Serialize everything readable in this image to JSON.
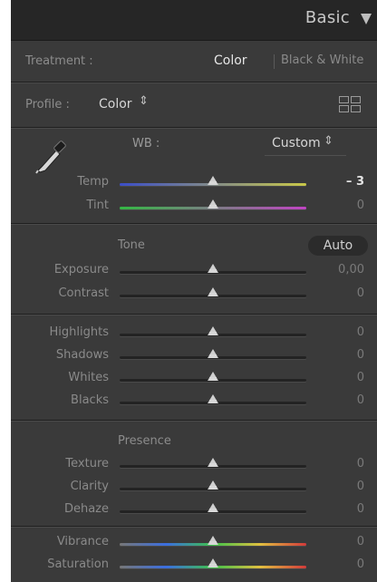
{
  "header": {
    "title": "Basic"
  },
  "treatment": {
    "label": "Treatment :",
    "color": "Color",
    "bw": "Black & White"
  },
  "profile": {
    "label": "Profile :",
    "value": "Color",
    "stepper": "⇕"
  },
  "wb": {
    "label": "WB :",
    "value": "Custom",
    "stepper": "⇕"
  },
  "temp": {
    "label": "Temp",
    "value": "– 3",
    "position": 0.5
  },
  "tint": {
    "label": "Tint",
    "value": "0",
    "position": 0.5
  },
  "tone": {
    "title": "Tone",
    "auto_label": "Auto"
  },
  "exposure": {
    "label": "Exposure",
    "value": "0,00",
    "position": 0.5
  },
  "contrast": {
    "label": "Contrast",
    "value": "0",
    "position": 0.5
  },
  "highlights": {
    "label": "Highlights",
    "value": "0",
    "position": 0.5
  },
  "shadows": {
    "label": "Shadows",
    "value": "0",
    "position": 0.5
  },
  "whites": {
    "label": "Whites",
    "value": "0",
    "position": 0.5
  },
  "blacks": {
    "label": "Blacks",
    "value": "0",
    "position": 0.5
  },
  "presence": {
    "title": "Presence"
  },
  "texture": {
    "label": "Texture",
    "value": "0",
    "position": 0.5
  },
  "clarity": {
    "label": "Clarity",
    "value": "0",
    "position": 0.5
  },
  "dehaze": {
    "label": "Dehaze",
    "value": "0",
    "position": 0.5
  },
  "vibrance": {
    "label": "Vibrance",
    "value": "0",
    "position": 0.5
  },
  "saturation": {
    "label": "Saturation",
    "value": "0",
    "position": 0.5
  },
  "colors": {
    "temp_gradient": [
      "#3b4ec8",
      "#c9c848"
    ],
    "tint_gradient": [
      "#34b844",
      "#c144c4"
    ],
    "vib_gradient": [
      "#777777",
      "#3b6ee0",
      "#3ec24a",
      "#e0c040",
      "#d23a3a"
    ]
  }
}
